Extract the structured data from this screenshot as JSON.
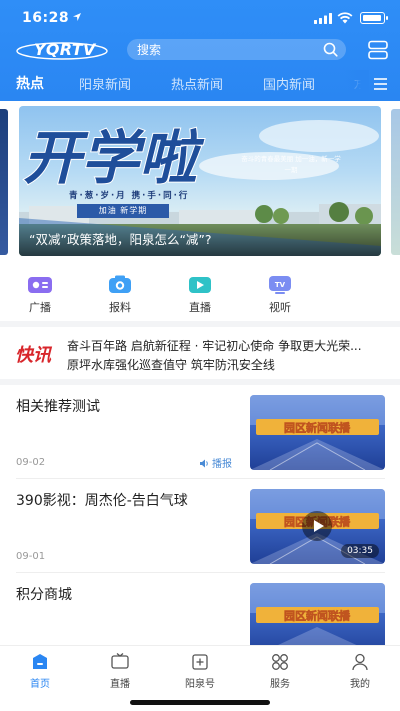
{
  "status_bar": {
    "time": "16:28"
  },
  "header": {
    "logo_text": "YQRTV",
    "search": {
      "placeholder": "搜索"
    },
    "tabs": [
      {
        "label": "热点",
        "active": true
      },
      {
        "label": "阳泉新闻",
        "active": false
      },
      {
        "label": "热点新闻",
        "active": false
      },
      {
        "label": "国内新闻",
        "active": false
      },
      {
        "label": "万",
        "active": false
      }
    ]
  },
  "banner": {
    "headline": "开学啦",
    "subline": "青·葱·岁·月  携·手·同·行",
    "ribbon": "加油 新学期",
    "quote": "奋斗的青春最美丽 加一油，新一学一期",
    "caption": "“双减”政策落地，阳泉怎么“减”?"
  },
  "quick_links": [
    {
      "label": "广播",
      "icon": "radio-icon",
      "color": "#8a6df0"
    },
    {
      "label": "报料",
      "icon": "camera-icon",
      "color": "#3fa0f5"
    },
    {
      "label": "直播",
      "icon": "live-video-icon",
      "color": "#2fc2c7"
    },
    {
      "label": "视听",
      "icon": "tv-icon",
      "color": "#7b8df2"
    }
  ],
  "ticker": {
    "badge": "快讯",
    "lines": [
      "奋斗百年路 启航新征程 · 牢记初心使命 争取更大光荣...",
      "原坪水库强化巡查值守 筑牢防汛安全线"
    ]
  },
  "articles": [
    {
      "title": "相关推荐测试",
      "date": "09-02",
      "tag": "播报",
      "thumb_text": "园区新闻联播",
      "duration": ""
    },
    {
      "title": "390影视：周杰伦-告白气球",
      "date": "09-01",
      "tag": "",
      "thumb_text": "园区新闻联播",
      "duration": "03:35"
    },
    {
      "title": "积分商城",
      "date": "",
      "tag": "",
      "thumb_text": "园区新闻联播",
      "duration": ""
    }
  ],
  "bottom_nav": [
    {
      "label": "首页",
      "icon": "home-icon",
      "active": true
    },
    {
      "label": "直播",
      "icon": "tv-live-icon",
      "active": false
    },
    {
      "label": "阳泉号",
      "icon": "plus-square-icon",
      "active": false
    },
    {
      "label": "服务",
      "icon": "grid-icon",
      "active": false
    },
    {
      "label": "我的",
      "icon": "user-icon",
      "active": false
    }
  ],
  "colors": {
    "brand_blue": "#2a86f2",
    "ticker_red": "#d8262b",
    "tag_blue": "#4a8bd6"
  }
}
